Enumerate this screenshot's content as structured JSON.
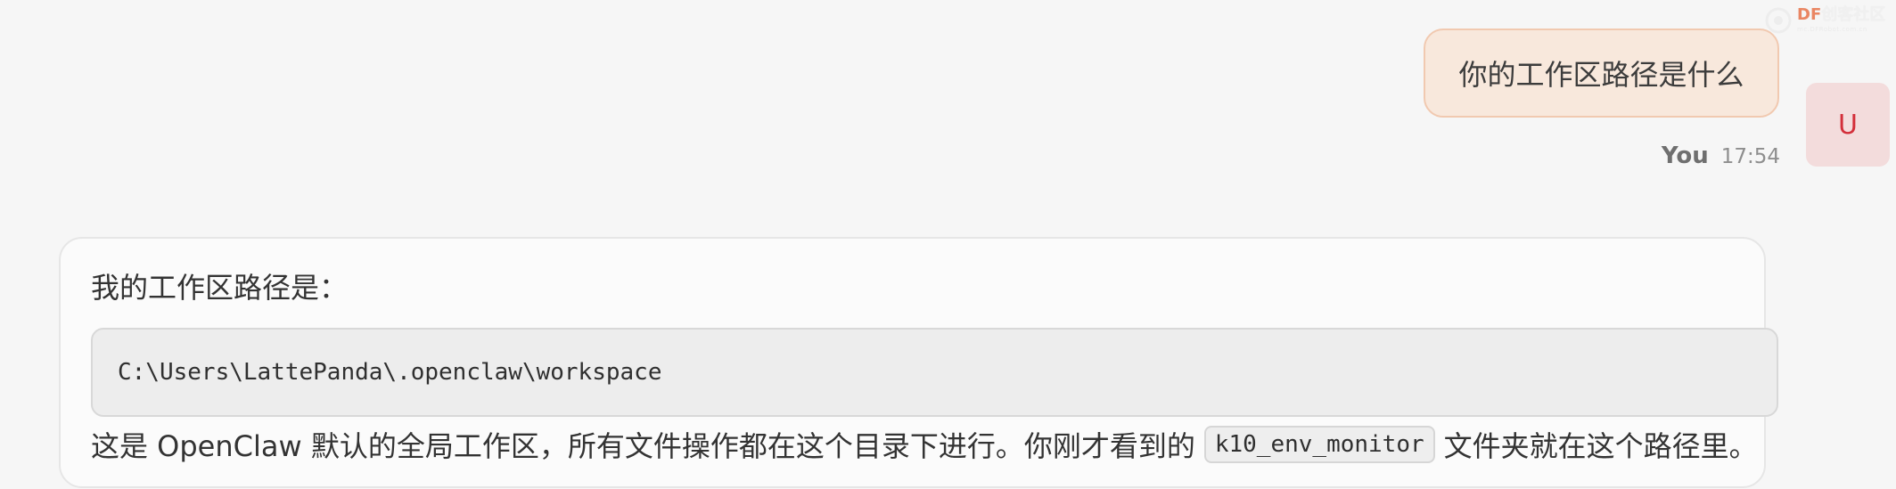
{
  "watermark": {
    "brand_prefix": "DF",
    "brand_main": "创客社区",
    "brand_sub": "mc.DFRobot.com.cn"
  },
  "user_message": {
    "text": "你的工作区路径是什么",
    "sender": "You",
    "time": "17:54",
    "avatar_letter": "U"
  },
  "assistant_message": {
    "intro": "我的工作区路径是：",
    "code_path": "C:\\Users\\LattePanda\\.openclaw\\workspace",
    "explain_before": "这是 OpenClaw 默认的全局工作区，所有文件操作都在这个目录下进行。你刚才看到的",
    "inline_code": "k10_env_monitor",
    "explain_after": "文件夹就在这个路径里。"
  },
  "colors": {
    "user_bubble_bg": "#f8e8dc",
    "user_bubble_border": "#f1c9b0",
    "avatar_bg": "#f3dcdc",
    "avatar_text": "#d32f3a",
    "page_bg": "#f6f6f6"
  }
}
